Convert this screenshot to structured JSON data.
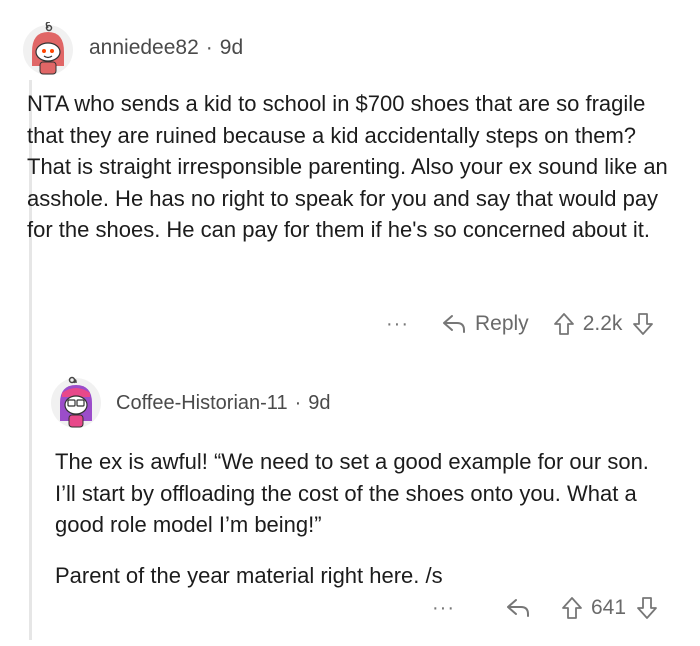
{
  "comments": [
    {
      "username": "anniedee82",
      "separator": "·",
      "age": "9d",
      "body": "NTA who sends a kid to school in $700 shoes that are so fragile that they are ruined because a kid accidentally steps on them? That is straight irresponsible parenting. Also your ex sound like an asshole. He has no right to speak for you and say that would pay for the shoes. He can pay for them if he's so concerned about it.",
      "more_label": "···",
      "reply_label": "Reply",
      "score": "2.2k",
      "avatar_color": "#e06666"
    },
    {
      "username": "Coffee-Historian-11",
      "separator": "·",
      "age": "9d",
      "paragraphs": [
        "The ex is awful! “We need to set a good example for our son. I’ll start by offloading the cost of the shoes onto you. What a good role model I’m being!”",
        "Parent of the year material right here. /s"
      ],
      "more_label": "···",
      "score": "641",
      "avatar_color": "#9b4dca"
    }
  ],
  "icons": [
    "snoo-avatar-icon",
    "more-options-icon",
    "reply-arrow-icon",
    "upvote-icon",
    "downvote-icon"
  ]
}
